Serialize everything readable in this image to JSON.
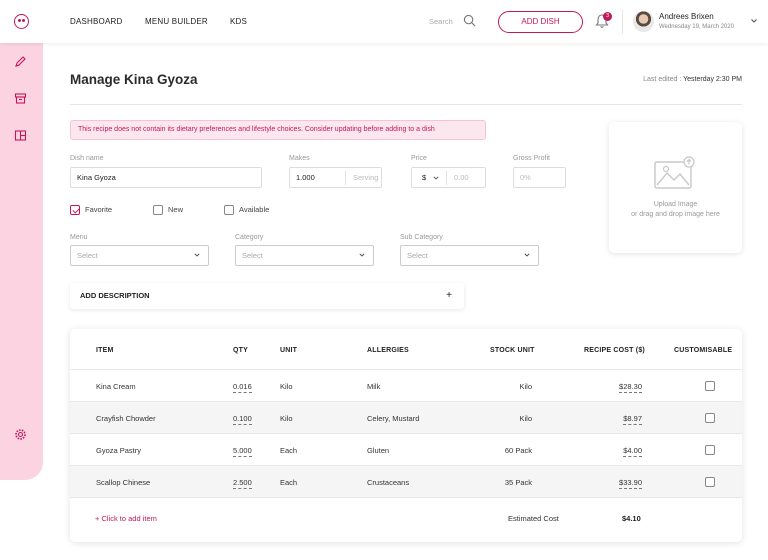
{
  "header": {
    "nav": [
      "DASHBOARD",
      "MENU BUILDER",
      "KDS"
    ],
    "search_label": "Search",
    "add_dish_label": "ADD DISH",
    "notification_count": "3",
    "user_name": "Andrees Brixen",
    "user_date": "Wednesday 19, March 2020"
  },
  "page": {
    "title": "Manage Kina Gyoza",
    "last_edited_label": "Last edited :",
    "last_edited_value": "Yesterday 2:30 PM",
    "alert": "This recipe does not contain its dietary preferences and lifestyle choices. Consider updating before adding to a dish"
  },
  "form": {
    "dish_name_label": "Dish name",
    "dish_name_value": "Kina Gyoza",
    "makes_label": "Makes",
    "makes_value": "1.000",
    "makes_unit": "Serving",
    "price_label": "Price",
    "price_currency": "$",
    "price_placeholder": "0.00",
    "gross_profit_label": "Gross Profit",
    "gross_profit_placeholder": "0%",
    "checkboxes": [
      {
        "label": "Favorite",
        "checked": true
      },
      {
        "label": "New",
        "checked": false
      },
      {
        "label": "Available",
        "checked": false
      }
    ],
    "menu_label": "Menu",
    "menu_value": "Select",
    "category_label": "Category",
    "category_value": "Select",
    "subcategory_label": "Sub Category",
    "subcategory_value": "Select",
    "add_description_label": "ADD DESCRIPTION",
    "add_description_plus": "+"
  },
  "upload": {
    "line1": "Upload Image",
    "line2": "or drag and drop image here"
  },
  "table": {
    "headers": [
      "ITEM",
      "QTY",
      "UNIT",
      "ALLERGIES",
      "STOCK UNIT",
      "RECIPE COST ($)",
      "CUSTOMISABLE"
    ],
    "rows": [
      {
        "item": "Kina Cream",
        "qty": "0.016",
        "unit": "Kilo",
        "allergies": "Milk",
        "stock_unit": "Kilo",
        "cost": "$28.30"
      },
      {
        "item": "Crayfish Chowder",
        "qty": "0.100",
        "unit": "Kilo",
        "allergies": "Celery, Mustard",
        "stock_unit": "Kilo",
        "cost": "$8.97"
      },
      {
        "item": "Gyoza Pastry",
        "qty": "5.000",
        "unit": "Each",
        "allergies": "Gluten",
        "stock_unit": "60 Pack",
        "cost": "$4.00"
      },
      {
        "item": "Scallop Chinese",
        "qty": "2.500",
        "unit": "Each",
        "allergies": "Crustaceans",
        "stock_unit": "35 Pack",
        "cost": "$33.90"
      }
    ],
    "add_item_label": "+  Click to add item",
    "estimated_cost_label": "Estimated Cost",
    "estimated_cost_value": "$4.10"
  },
  "colors": {
    "accent": "#c2185b",
    "sidebar": "#fbd3e1"
  }
}
